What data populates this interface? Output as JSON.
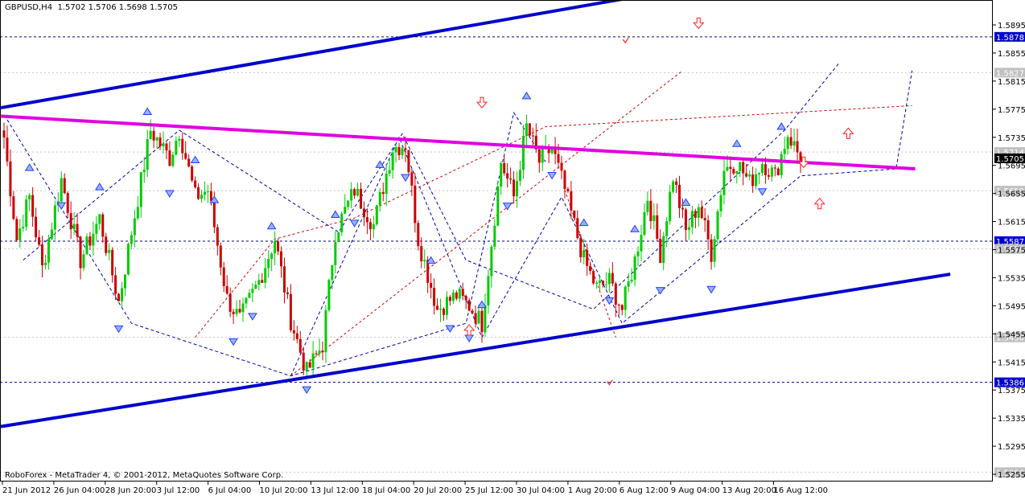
{
  "header": {
    "symbol": "GBPUSD,H4",
    "ohlc": "1.5702 1.5706 1.5698 1.5705"
  },
  "footer": {
    "copyright": "RoboForex - MetaTrader 4, © 2001-2012, MetaQuotes Software Corp."
  },
  "colors": {
    "bull": "#00cc00",
    "bear": "#cc0000",
    "channel": "#0000cc",
    "trend_pink": "#e000e0",
    "fan_blue": "#0000aa",
    "fan_red": "#cc0000",
    "level": "#000080",
    "arrow_red": "#ff2020",
    "arrow_blue": "#2040ff"
  },
  "chart_data": {
    "type": "candlestick",
    "title": "GBPUSD,H4",
    "ylim": [
      1.5247,
      1.5934
    ],
    "y_ticks": [
      "1.5895",
      "1.5855",
      "1.5815",
      "1.5775",
      "1.5735",
      "1.5695",
      "1.5655",
      "1.5615",
      "1.5575",
      "1.5535",
      "1.5495",
      "1.5455",
      "1.5415",
      "1.5375",
      "1.5335",
      "1.5295",
      "1.5255"
    ],
    "x_ticks": [
      "21 Jun 2012",
      "26 Jun 04:00",
      "28 Jun 20:00",
      "3 Jul 12:00",
      "6 Jul 04:00",
      "10 Jul 20:00",
      "13 Jul 12:00",
      "18 Jul 04:00",
      "20 Jul 20:00",
      "25 Jul 12:00",
      "30 Jul 04:00",
      "1 Aug 20:00",
      "6 Aug 12:00",
      "9 Aug 04:00",
      "13 Aug 20:00",
      "16 Aug 12:00"
    ],
    "highlighted_levels": [
      {
        "label": "1.5878",
        "value": 1.5878,
        "style": "dashed"
      },
      {
        "label": "1.5827",
        "value": 1.5827,
        "style": "grey-tag"
      },
      {
        "label": "1.5714",
        "value": 1.5714,
        "style": "grey-tag"
      },
      {
        "label": "1.5705",
        "value": 1.5705,
        "style": "current"
      },
      {
        "label": "1.5659",
        "value": 1.5659,
        "style": "grey-tag"
      },
      {
        "label": "1.5587",
        "value": 1.5587,
        "style": "dashed"
      },
      {
        "label": "1.5576",
        "value": 1.5576,
        "style": "grey-tag"
      },
      {
        "label": "1.5450",
        "value": 1.545,
        "style": "grey-tag"
      },
      {
        "label": "1.5386",
        "value": 1.5386,
        "style": "dashed"
      },
      {
        "label": "1.5258",
        "value": 1.5258,
        "style": "grey-tag"
      }
    ],
    "anchors": [
      [
        0,
        1.5735
      ],
      [
        4,
        1.559
      ],
      [
        8,
        1.565
      ],
      [
        12,
        1.5548
      ],
      [
        18,
        1.5675
      ],
      [
        24,
        1.556
      ],
      [
        30,
        1.562
      ],
      [
        36,
        1.55
      ],
      [
        40,
        1.56
      ],
      [
        46,
        1.5745
      ],
      [
        52,
        1.5705
      ],
      [
        55,
        1.5745
      ],
      [
        60,
        1.565
      ],
      [
        64,
        1.566
      ],
      [
        70,
        1.5505
      ],
      [
        74,
        1.5475
      ],
      [
        80,
        1.553
      ],
      [
        85,
        1.559
      ],
      [
        90,
        1.5475
      ],
      [
        95,
        1.54
      ],
      [
        100,
        1.544
      ],
      [
        104,
        1.56
      ],
      [
        110,
        1.566
      ],
      [
        116,
        1.561
      ],
      [
        122,
        1.572
      ],
      [
        126,
        1.5725
      ],
      [
        130,
        1.559
      ],
      [
        136,
        1.549
      ],
      [
        142,
        1.551
      ],
      [
        146,
        1.5495
      ],
      [
        150,
        1.547
      ],
      [
        156,
        1.57
      ],
      [
        160,
        1.565
      ],
      [
        164,
        1.575
      ],
      [
        168,
        1.57
      ],
      [
        172,
        1.572
      ],
      [
        176,
        1.566
      ],
      [
        182,
        1.556
      ],
      [
        186,
        1.552
      ],
      [
        190,
        1.553
      ],
      [
        194,
        1.549
      ],
      [
        198,
        1.556
      ],
      [
        202,
        1.565
      ],
      [
        206,
        1.557
      ],
      [
        210,
        1.568
      ],
      [
        214,
        1.56
      ],
      [
        218,
        1.564
      ],
      [
        222,
        1.557
      ],
      [
        226,
        1.569
      ],
      [
        230,
        1.57
      ],
      [
        234,
        1.567
      ],
      [
        238,
        1.57
      ],
      [
        242,
        1.568
      ],
      [
        246,
        1.574
      ],
      [
        250,
        1.5705
      ]
    ],
    "candle_count": 251,
    "channel_upper": [
      [
        -1,
        1.5777
      ],
      [
        207,
        1.5942
      ]
    ],
    "channel_lower": [
      [
        -1,
        1.5323
      ],
      [
        297,
        1.554
      ]
    ],
    "pink_trendline": [
      [
        -1,
        1.5765
      ],
      [
        286,
        1.569
      ]
    ]
  }
}
